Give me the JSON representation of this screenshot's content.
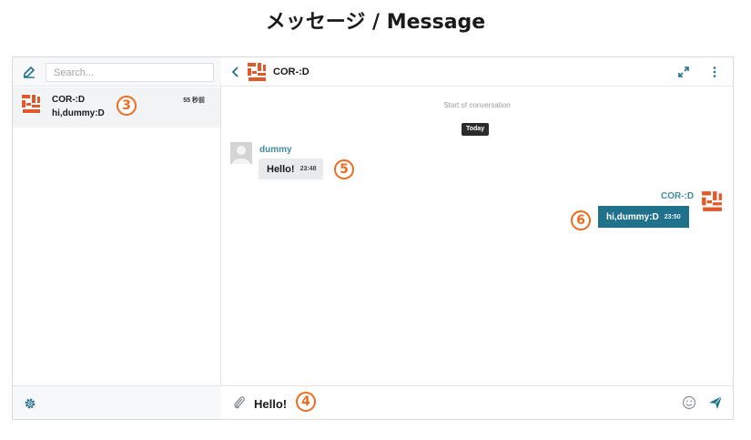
{
  "page": {
    "title": "メッセージ / Message"
  },
  "sidebar": {
    "search_placeholder": "Search...",
    "conversation": {
      "name": "COR-:D",
      "preview": "hi,dummy:D",
      "time": "55 秒前"
    }
  },
  "chat": {
    "title": "COR-:D",
    "start_label": "Start of conversation",
    "date_label": "Today",
    "messages": [
      {
        "sender": "dummy",
        "text": "Hello!",
        "time": "23:48",
        "direction": "incoming"
      },
      {
        "sender": "COR-:D",
        "text": "hi,dummy:D",
        "time": "23:50",
        "direction": "outgoing"
      }
    ],
    "composer_value": "Hello!"
  },
  "callouts": {
    "c3": "3",
    "c4": "4",
    "c5": "5",
    "c6": "6"
  },
  "colors": {
    "accent": "#20728c",
    "name_text": "#3f8ca0",
    "callout": "#ef6b1f",
    "avatar_red": "#e2582a"
  },
  "icons": [
    "compose-icon",
    "settings-icon",
    "back-icon",
    "expand-icon",
    "more-icon",
    "attach-icon",
    "emoji-icon",
    "send-icon"
  ]
}
